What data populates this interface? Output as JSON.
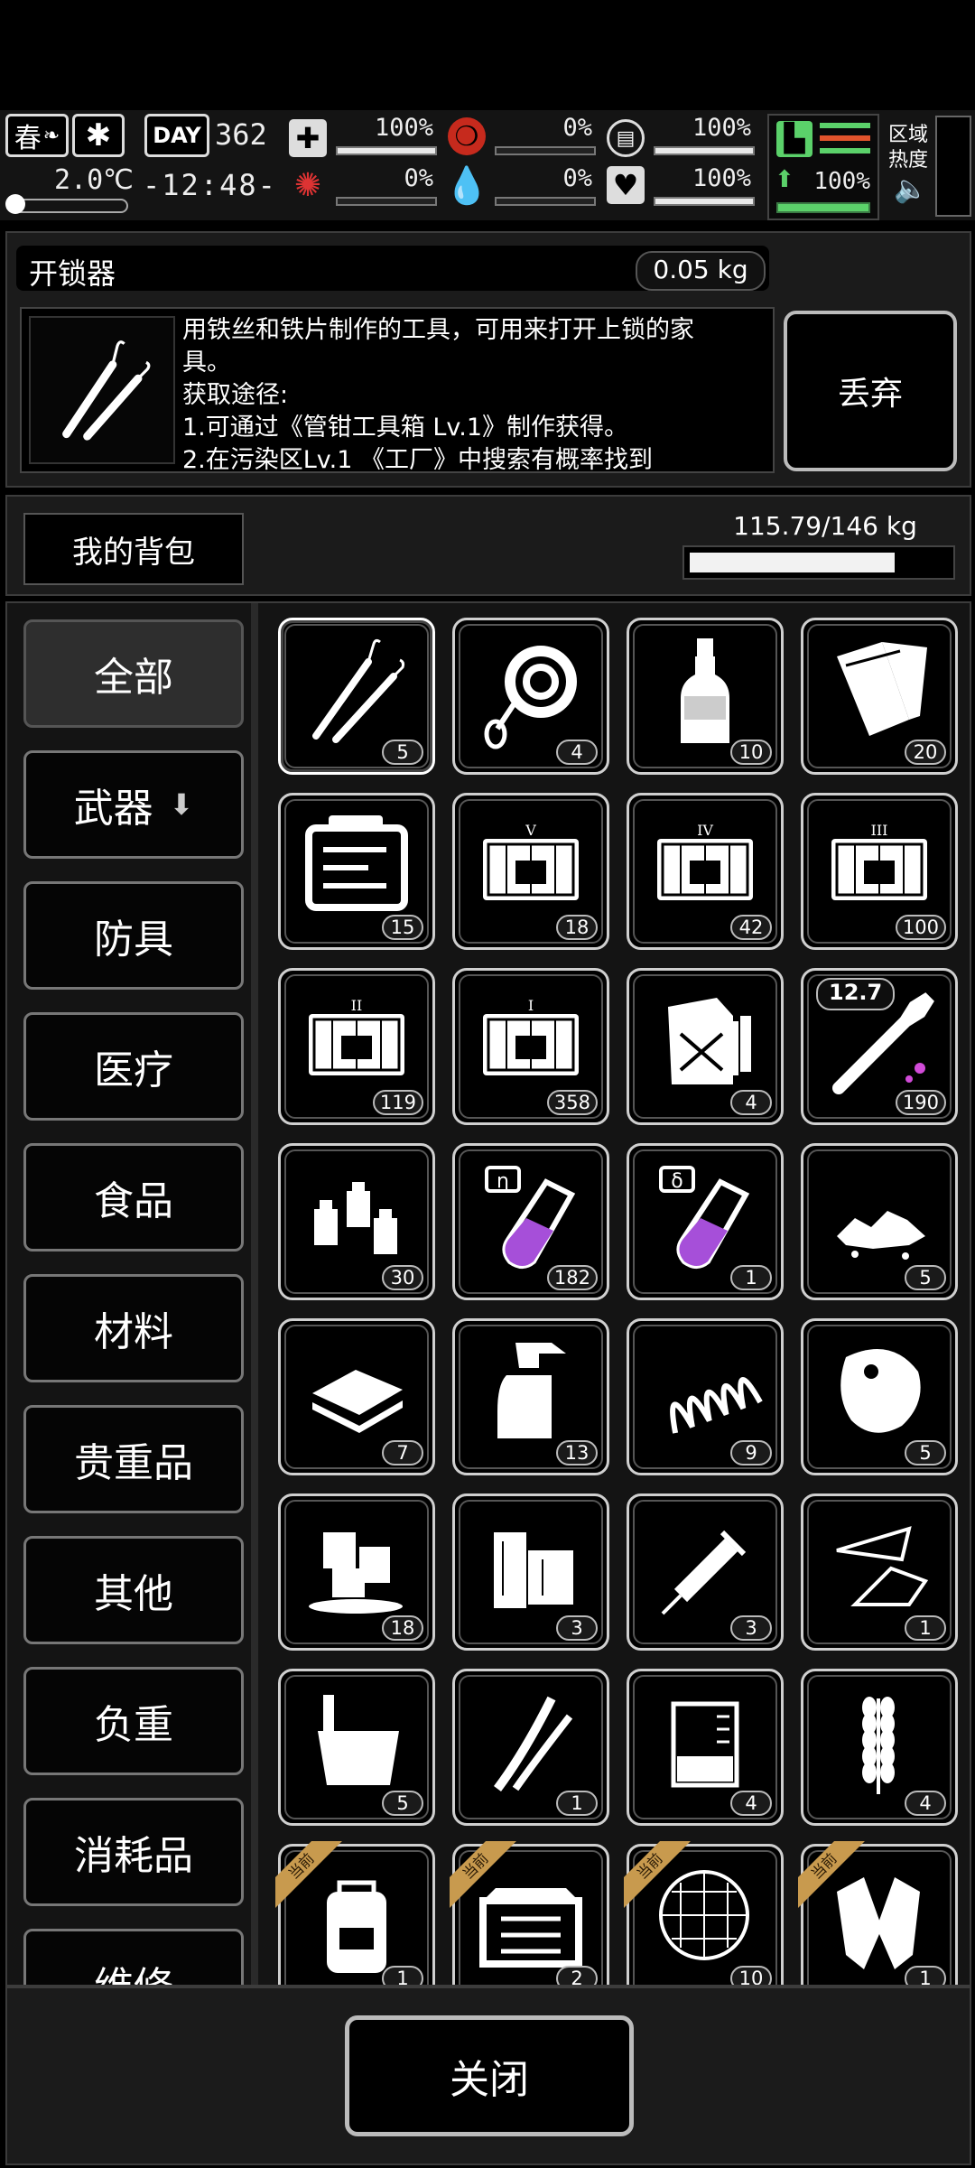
{
  "status": {
    "season": "春",
    "temperature": "2.0℃",
    "day_label": "DAY",
    "day": "362",
    "clock": "-12:48-",
    "health_pct": "100%",
    "health_fill": 1.0,
    "hunger_pct": "0%",
    "hunger_fill": 0.0,
    "armor_pct": "100%",
    "armor_fill": 1.0,
    "infection_pct": "0%",
    "infection_fill": 0.0,
    "thirst_pct": "0%",
    "thirst_fill": 0.0,
    "mood_pct": "100%",
    "mood_fill": 1.0,
    "stamina_pct": "100%",
    "stamina_fill": 1.0,
    "region_heat_label": "区域热度"
  },
  "item_detail": {
    "name": "开锁器",
    "weight": "0.05 kg",
    "description_line1": "用铁丝和铁片制作的工具，可用来打开上锁的家",
    "description_line2": "具。",
    "description_line3": "获取途径:",
    "description_line4": "1.可通过《管钳工具箱 Lv.1》制作获得。",
    "description_line5": "2.在污染区Lv.1 《工厂》中搜索有概率找到",
    "discard_label": "丢弃"
  },
  "backpack": {
    "title": "我的背包",
    "capacity": "115.79/146 kg",
    "fill": 0.793
  },
  "categories": [
    "全部",
    "武器",
    "防具",
    "医疗",
    "食品",
    "材料",
    "贵重品",
    "其他",
    "负重",
    "消耗品",
    "维修"
  ],
  "items": [
    {
      "icon": "lockpick-icon",
      "count": "5"
    },
    {
      "icon": "rope-icon",
      "count": "4"
    },
    {
      "icon": "bottle-icon",
      "count": "10"
    },
    {
      "icon": "cloth-roll-icon",
      "count": "20"
    },
    {
      "icon": "toolbox-icon",
      "count": "15"
    },
    {
      "icon": "crate-v-icon",
      "count": "18"
    },
    {
      "icon": "crate-iv-icon",
      "count": "42"
    },
    {
      "icon": "crate-iii-icon",
      "count": "100"
    },
    {
      "icon": "crate-ii-icon",
      "count": "119"
    },
    {
      "icon": "crate-i-icon",
      "count": "358"
    },
    {
      "icon": "fuel-can-icon",
      "count": "4"
    },
    {
      "icon": "bullet-icon",
      "count": "190",
      "tag": "12.7"
    },
    {
      "icon": "bottles-icon",
      "count": "30"
    },
    {
      "icon": "serum-eta-icon",
      "count": "182",
      "tag_glyph": "η"
    },
    {
      "icon": "serum-delta-icon",
      "count": "1",
      "tag_glyph": "δ"
    },
    {
      "icon": "stones-icon",
      "count": "5"
    },
    {
      "icon": "bread-icon",
      "count": "7"
    },
    {
      "icon": "spray-bottle-icon",
      "count": "13"
    },
    {
      "icon": "spring-icon",
      "count": "9"
    },
    {
      "icon": "meat-icon",
      "count": "5"
    },
    {
      "icon": "ice-icon",
      "count": "18"
    },
    {
      "icon": "wood-icon",
      "count": "3"
    },
    {
      "icon": "syringe-icon",
      "count": "3"
    },
    {
      "icon": "glass-shard-icon",
      "count": "1"
    },
    {
      "icon": "bucket-icon",
      "count": "5"
    },
    {
      "icon": "scallion-icon",
      "count": "1"
    },
    {
      "icon": "beaker-icon",
      "count": "4"
    },
    {
      "icon": "wheat-icon",
      "count": "4"
    },
    {
      "icon": "backpack-icon",
      "count": "1",
      "equipped": "当前"
    },
    {
      "icon": "storage-box-icon",
      "count": "2",
      "equipped": "当前"
    },
    {
      "icon": "net-icon",
      "count": "10",
      "equipped": "当前"
    },
    {
      "icon": "gloves-icon",
      "count": "1",
      "equipped": "当前"
    }
  ],
  "close_label": "关闭"
}
